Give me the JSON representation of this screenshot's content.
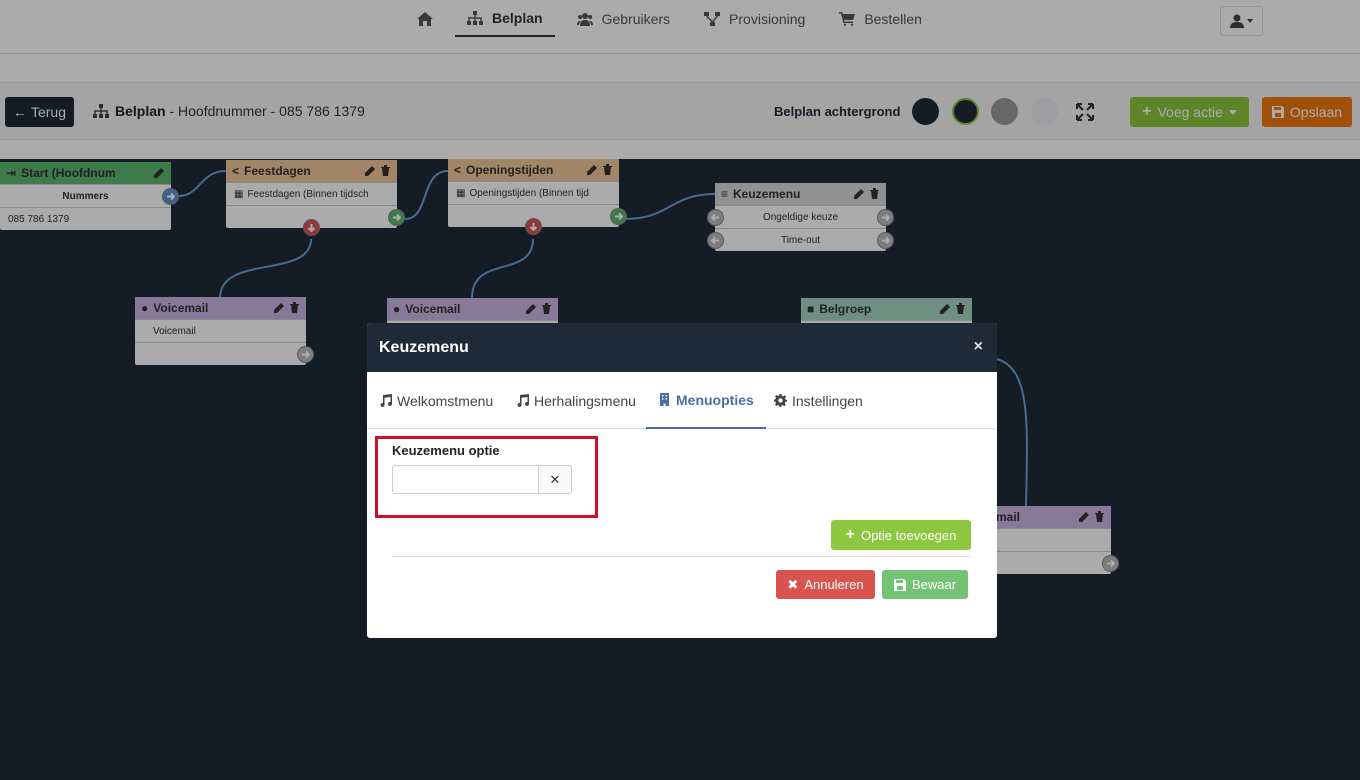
{
  "nav": {
    "items": [
      {
        "label": "",
        "icon": "home-icon"
      },
      {
        "label": "Belplan",
        "icon": "sitemap-icon",
        "active": true
      },
      {
        "label": "Gebruikers",
        "icon": "users-icon"
      },
      {
        "label": "Provisioning",
        "icon": "network-icon"
      },
      {
        "label": "Bestellen",
        "icon": "cart-icon"
      }
    ],
    "user_icon": "user-icon"
  },
  "toolbar": {
    "back_label": "Terug",
    "crumb_title": "Belplan",
    "crumb_sub": " - Hoofdnummer - 085 786 1379",
    "bg_label": "Belplan achtergrond",
    "swatches": [
      "#1e2a38",
      "#1e2a38",
      "#9a9a9a",
      "#ececf2"
    ],
    "add_action_label": "Voeg actie",
    "save_label": "Opslaan"
  },
  "canvas": {
    "nodes": {
      "start": {
        "title": "Start (Hoofdnum",
        "row1": "Nummers",
        "row2": "085 786 1379",
        "color": "#5cb870"
      },
      "feestdagen": {
        "title": "Feestdagen",
        "row1": "Feestdagen (Binnen tijdsch",
        "color": "#f0c69a"
      },
      "openingstijden": {
        "title": "Openingstijden",
        "row1": "Openingstijden (Binnen tijd",
        "color": "#f0c69a"
      },
      "keuzemenu": {
        "title": "Keuzemenu",
        "row1": "Ongeldige keuze",
        "row2": "Time-out",
        "color": "#d8d8d8"
      },
      "voicemail1": {
        "title": "Voicemail",
        "row1": "Voicemail",
        "color": "#c9b6e4"
      },
      "voicemail2": {
        "title": "Voicemail",
        "color": "#c9b6e4"
      },
      "belgroep": {
        "title": "Belgroep",
        "color": "#a6d6c4"
      },
      "voicemail3": {
        "title": "mail",
        "color": "#c9b6e4"
      }
    }
  },
  "modal": {
    "title": "Keuzemenu",
    "close_label": "×",
    "tabs": [
      {
        "label": "Welkomstmenu",
        "icon": "music-icon"
      },
      {
        "label": "Herhalingsmenu",
        "icon": "music-icon"
      },
      {
        "label": "Menuopties",
        "icon": "building-icon",
        "active": true
      },
      {
        "label": "Instellingen",
        "icon": "gear-icon"
      }
    ],
    "field_label": "Keuzemenu optie",
    "field_value": "",
    "clear_label": "✕",
    "add_option_label": "Optie toevoegen",
    "cancel_label": "Annuleren",
    "store_label": "Bewaar"
  }
}
